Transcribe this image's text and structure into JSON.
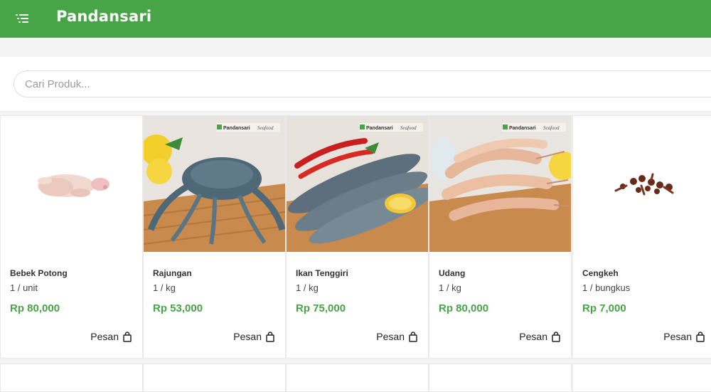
{
  "header": {
    "brand": "Pandansari",
    "menu_icon": "menu-list-icon",
    "color": "#47a447"
  },
  "search": {
    "placeholder": "Cari Produk..."
  },
  "products": [
    {
      "name": "Bebek Potong",
      "unit": "1 / unit",
      "price": "Rp 80,000",
      "order_label": "Pesan",
      "order_icon": "shopping-bag-icon"
    },
    {
      "name": "Rajungan",
      "unit": "1 / kg",
      "price": "Rp 53,000",
      "order_label": "Pesan",
      "order_icon": "shopping-bag-icon",
      "image_brand": "Pandansari",
      "image_partner": "Seafood"
    },
    {
      "name": "Ikan Tenggiri",
      "unit": "1 / kg",
      "price": "Rp 75,000",
      "order_label": "Pesan",
      "order_icon": "shopping-bag-icon",
      "image_brand": "Pandansari",
      "image_partner": "Seafood"
    },
    {
      "name": "Udang",
      "unit": "1 / kg",
      "price": "Rp 80,000",
      "order_label": "Pesan",
      "order_icon": "shopping-bag-icon",
      "image_brand": "Pandansari",
      "image_partner": "Seafood"
    },
    {
      "name": "Cengkeh",
      "unit": "1 / bungkus",
      "price": "Rp 7,000",
      "order_label": "Pesan",
      "order_icon": "shopping-bag-icon"
    }
  ],
  "colors": {
    "price": "#47a447",
    "background": "#f4f4f4"
  }
}
